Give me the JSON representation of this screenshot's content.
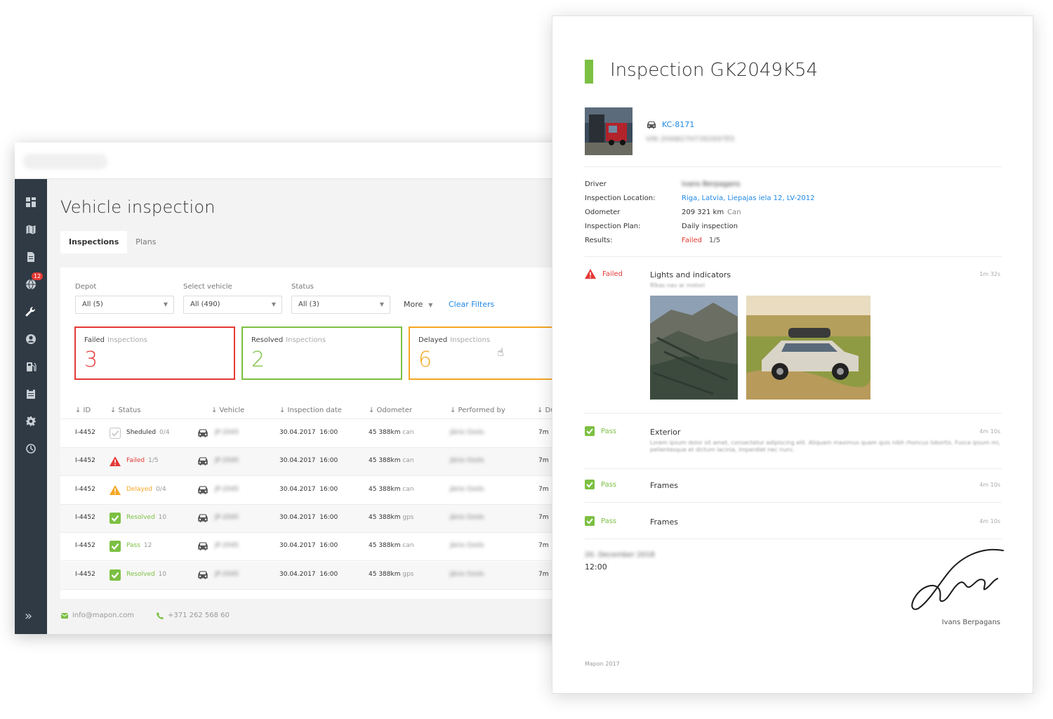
{
  "colors": {
    "sidebar_bg": "#2f3a45",
    "accent_green": "#7cc043",
    "failed_red": "#e53935",
    "delayed_orange": "#f5a623",
    "link_blue": "#1e88e5"
  },
  "sidebar": {
    "items": [
      {
        "icon": "dashboard-icon"
      },
      {
        "icon": "map-icon"
      },
      {
        "icon": "document-icon"
      },
      {
        "icon": "globe-icon",
        "badge": "12"
      },
      {
        "icon": "wrench-icon",
        "active": true
      },
      {
        "icon": "user-icon"
      },
      {
        "icon": "fuel-icon"
      },
      {
        "icon": "clipboard-icon"
      },
      {
        "icon": "gear-icon"
      },
      {
        "icon": "history-icon"
      }
    ],
    "expand_icon": "double-chevron-right-icon"
  },
  "page": {
    "title": "Vehicle inspection",
    "tabs": [
      {
        "label": "Inspections",
        "active": true
      },
      {
        "label": "Plans",
        "active": false
      }
    ]
  },
  "filters": {
    "depot": {
      "label": "Depot",
      "value": "All (5)"
    },
    "vehicle": {
      "label": "Select vehicle",
      "value": "All (490)"
    },
    "status": {
      "label": "Status",
      "value": "All (3)"
    },
    "more_label": "More",
    "clear_label": "Clear Filters"
  },
  "stats": [
    {
      "title": "Failed",
      "sub": "Inspections",
      "value": "3",
      "color": "#e53935"
    },
    {
      "title": "Resolved",
      "sub": "Inspections",
      "value": "2",
      "color": "#7cc043"
    },
    {
      "title": "Delayed",
      "sub": "Inspections",
      "value": "6",
      "color": "#f5a623"
    }
  ],
  "table": {
    "headers": [
      "↓ ID",
      "↓ Status",
      "↓ Vehicle",
      "↓ Inspection date",
      "↓ Odometer",
      "↓ Performed by",
      "↓ Du"
    ],
    "rows": [
      {
        "id": "I-4452",
        "status": "Sheduled",
        "status_type": "scheduled",
        "count": "0/4",
        "vehicle": "JP-2045",
        "date": "30.04.2017",
        "time": "16:00",
        "odometer": "45 388km",
        "source": "can",
        "performed_by": "Jānis Ozols",
        "duration": "7m"
      },
      {
        "id": "I-4452",
        "status": "Failed",
        "status_type": "failed",
        "count": "1/5",
        "vehicle": "JP-2045",
        "date": "30.04.2017",
        "time": "16:00",
        "odometer": "45 388km",
        "source": "can",
        "performed_by": "Jānis Ozols",
        "duration": "7m"
      },
      {
        "id": "I-4452",
        "status": "Delayed",
        "status_type": "delayed",
        "count": "0/4",
        "vehicle": "JP-2045",
        "date": "30.04.2017",
        "time": "16:00",
        "odometer": "45 388km",
        "source": "can",
        "performed_by": "Jānis Ozols",
        "duration": "7m"
      },
      {
        "id": "I-4452",
        "status": "Resolved",
        "status_type": "resolved",
        "count": "10",
        "vehicle": "JP-2045",
        "date": "30.04.2017",
        "time": "16:00",
        "odometer": "45 388km",
        "source": "gps",
        "performed_by": "Jānis Ozols",
        "duration": "7m"
      },
      {
        "id": "I-4452",
        "status": "Pass",
        "status_type": "pass",
        "count": "12",
        "vehicle": "JP-2045",
        "date": "30.04.2017",
        "time": "16:00",
        "odometer": "45 388km",
        "source": "can",
        "performed_by": "Jānis Ozols",
        "duration": "7m"
      },
      {
        "id": "I-4452",
        "status": "Resolved",
        "status_type": "resolved",
        "count": "10",
        "vehicle": "JP-2045",
        "date": "30.04.2017",
        "time": "16:00",
        "odometer": "45 388km",
        "source": "gps",
        "performed_by": "Jānis Ozols",
        "duration": "7m"
      }
    ]
  },
  "footer": {
    "email": "info@mapon.com",
    "phone": "+371 262 568 60"
  },
  "report": {
    "title": "Inspection GK2049K54",
    "vehicle_plate": "KC-8171",
    "vin": "VIN 2HA8G7H7392697E5",
    "fields": [
      {
        "label": "Driver",
        "value": "Ivans Berpagans",
        "blurred": true
      },
      {
        "label": "Inspection Location:",
        "value": "Riga, Latvia, Liepajas iela 12, LV-2012",
        "link": true
      },
      {
        "label": "Odometer",
        "value": "209 321 km",
        "unit": "Can"
      },
      {
        "label": "Inspection Plan:",
        "value": "Daily inspection"
      },
      {
        "label": "Results:",
        "value": "Failed",
        "extra": "1/5",
        "failed": true
      }
    ],
    "checks": [
      {
        "status": "Failed",
        "type": "failed",
        "title": "Lights and indicators",
        "sub": "Rīkas nav ar motori",
        "duration": "1m 32s"
      },
      {
        "status": "Pass",
        "type": "pass",
        "title": "Exterior",
        "desc": "Lorem ipsum dolor sit amet, consectetur adipiscing elit. Aliquam maximus quam quis nibh rhoncus lobortis. Fusce ipsum mi, pellentesque et dictum lacinia, imperdiet nec nunc.",
        "duration": "4m 10s"
      },
      {
        "status": "Pass",
        "type": "pass",
        "title": "Frames",
        "duration": "4m 10s"
      },
      {
        "status": "Pass",
        "type": "pass",
        "title": "Frames",
        "duration": "4m 10s"
      }
    ],
    "sign_date": "20. December 2018",
    "sign_time": "12:00",
    "signer": "Ivans Berpagans",
    "footer": "Mapon 2017"
  }
}
